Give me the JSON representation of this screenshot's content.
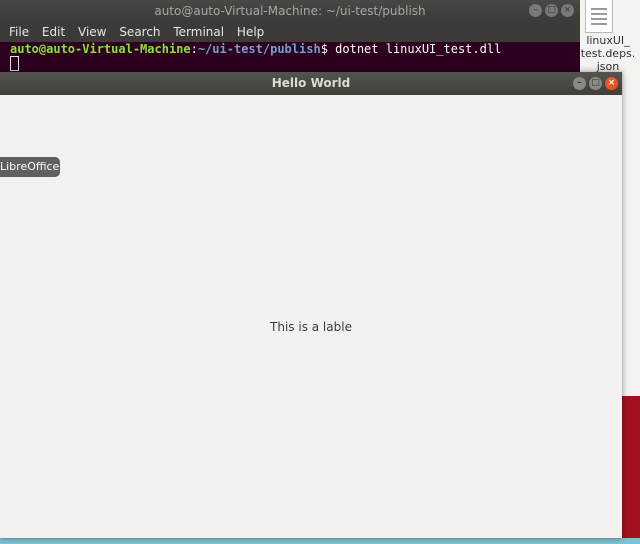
{
  "desktop": {
    "file_label": "linuxUI_\ntest.deps.\njson"
  },
  "terminal": {
    "title": "auto@auto-Virtual-Machine: ~/ui-test/publish",
    "menu": [
      "File",
      "Edit",
      "View",
      "Search",
      "Terminal",
      "Help"
    ],
    "prompt_user": "auto@auto-Virtual-Machine",
    "prompt_sep": ":",
    "prompt_path": "~/ui-test/publish",
    "prompt_symbol": "$ ",
    "command": "dotnet linuxUI_test.dll"
  },
  "hello_window": {
    "title": "Hello World",
    "tooltip": "LibreOffice Impress",
    "label": "This is a lable"
  },
  "colors": {
    "terminal_bg": "#2c001e",
    "prompt_user": "#8ae234",
    "prompt_path": "#729fcf",
    "close_button": "#e95420"
  }
}
